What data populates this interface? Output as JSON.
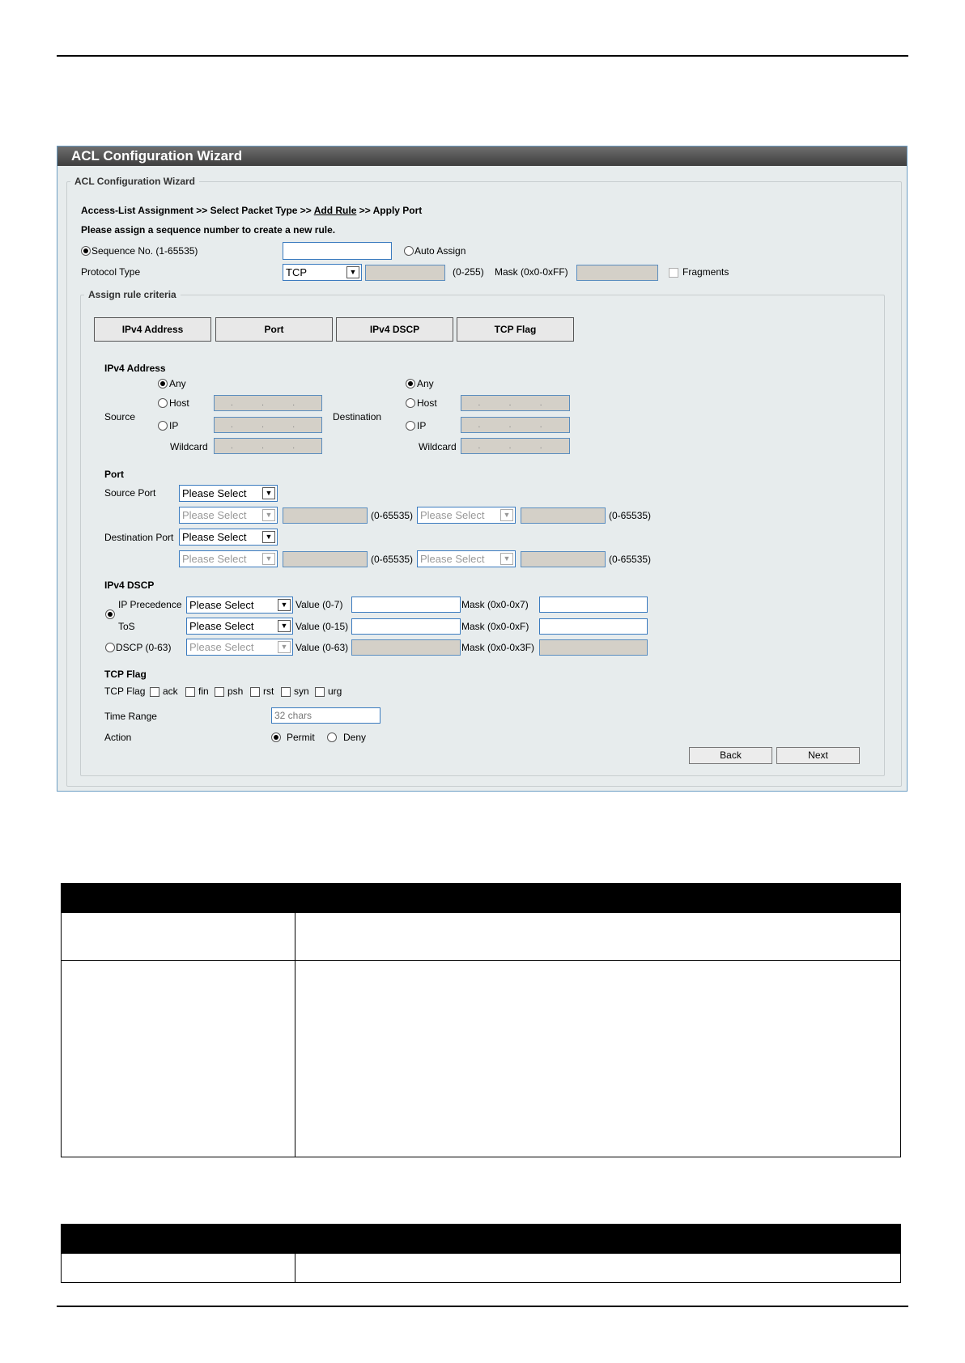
{
  "panel": {
    "title": "ACL Configuration Wizard",
    "legend": "ACL Configuration Wizard",
    "breadcrumb": {
      "step1": "Access-List Assignment >> Select Packet Type >>",
      "current": "Add Rule",
      "step3": ">> Apply Port"
    },
    "instruction": "Please assign a sequence number to create a new rule.",
    "sequence": {
      "label": "Sequence No. (1-65535)",
      "value": "",
      "auto_assign": "Auto Assign"
    },
    "protocol": {
      "label": "Protocol Type",
      "selected": "TCP",
      "range": "(0-255)",
      "mask_label": "Mask (0x0-0xFF)",
      "fragments": "Fragments"
    },
    "criteria": {
      "legend": "Assign rule criteria",
      "tabs": [
        "IPv4 Address",
        "Port",
        "IPv4 DSCP",
        "TCP Flag"
      ],
      "ipv4": {
        "heading": "IPv4 Address",
        "source_label": "Source",
        "destination_label": "Destination",
        "any": "Any",
        "host": "Host",
        "ip": "IP",
        "wildcard": "Wildcard",
        "ip_placeholder": ". . ."
      },
      "port": {
        "heading": "Port",
        "source_label": "Source Port",
        "destination_label": "Destination Port",
        "select": "Please Select",
        "range": "(0-65535)"
      },
      "dscp": {
        "heading": "IPv4 DSCP",
        "ip_precedence": "IP Precedence",
        "tos": "ToS",
        "dscp": "DSCP (0-63)",
        "select": "Please Select",
        "value_07": "Value (0-7)",
        "value_015": "Value (0-15)",
        "value_063": "Value (0-63)",
        "mask_07": "Mask (0x0-0x7)",
        "mask_0f": "Mask (0x0-0xF)",
        "mask_3f": "Mask (0x0-0x3F)"
      },
      "tcp_flag": {
        "heading": "TCP Flag",
        "label": "TCP Flag",
        "flags": [
          "ack",
          "fin",
          "psh",
          "rst",
          "syn",
          "urg"
        ]
      },
      "time_range": {
        "label": "Time Range",
        "placeholder": "32 chars"
      },
      "action": {
        "label": "Action",
        "permit": "Permit",
        "deny": "Deny"
      },
      "back": "Back",
      "next": "Next"
    }
  },
  "colors": {
    "title_bar": "#4a4a4a",
    "panel_bg": "#e7eced",
    "input_border": "#3b7bbf",
    "table_header": "#000000"
  }
}
